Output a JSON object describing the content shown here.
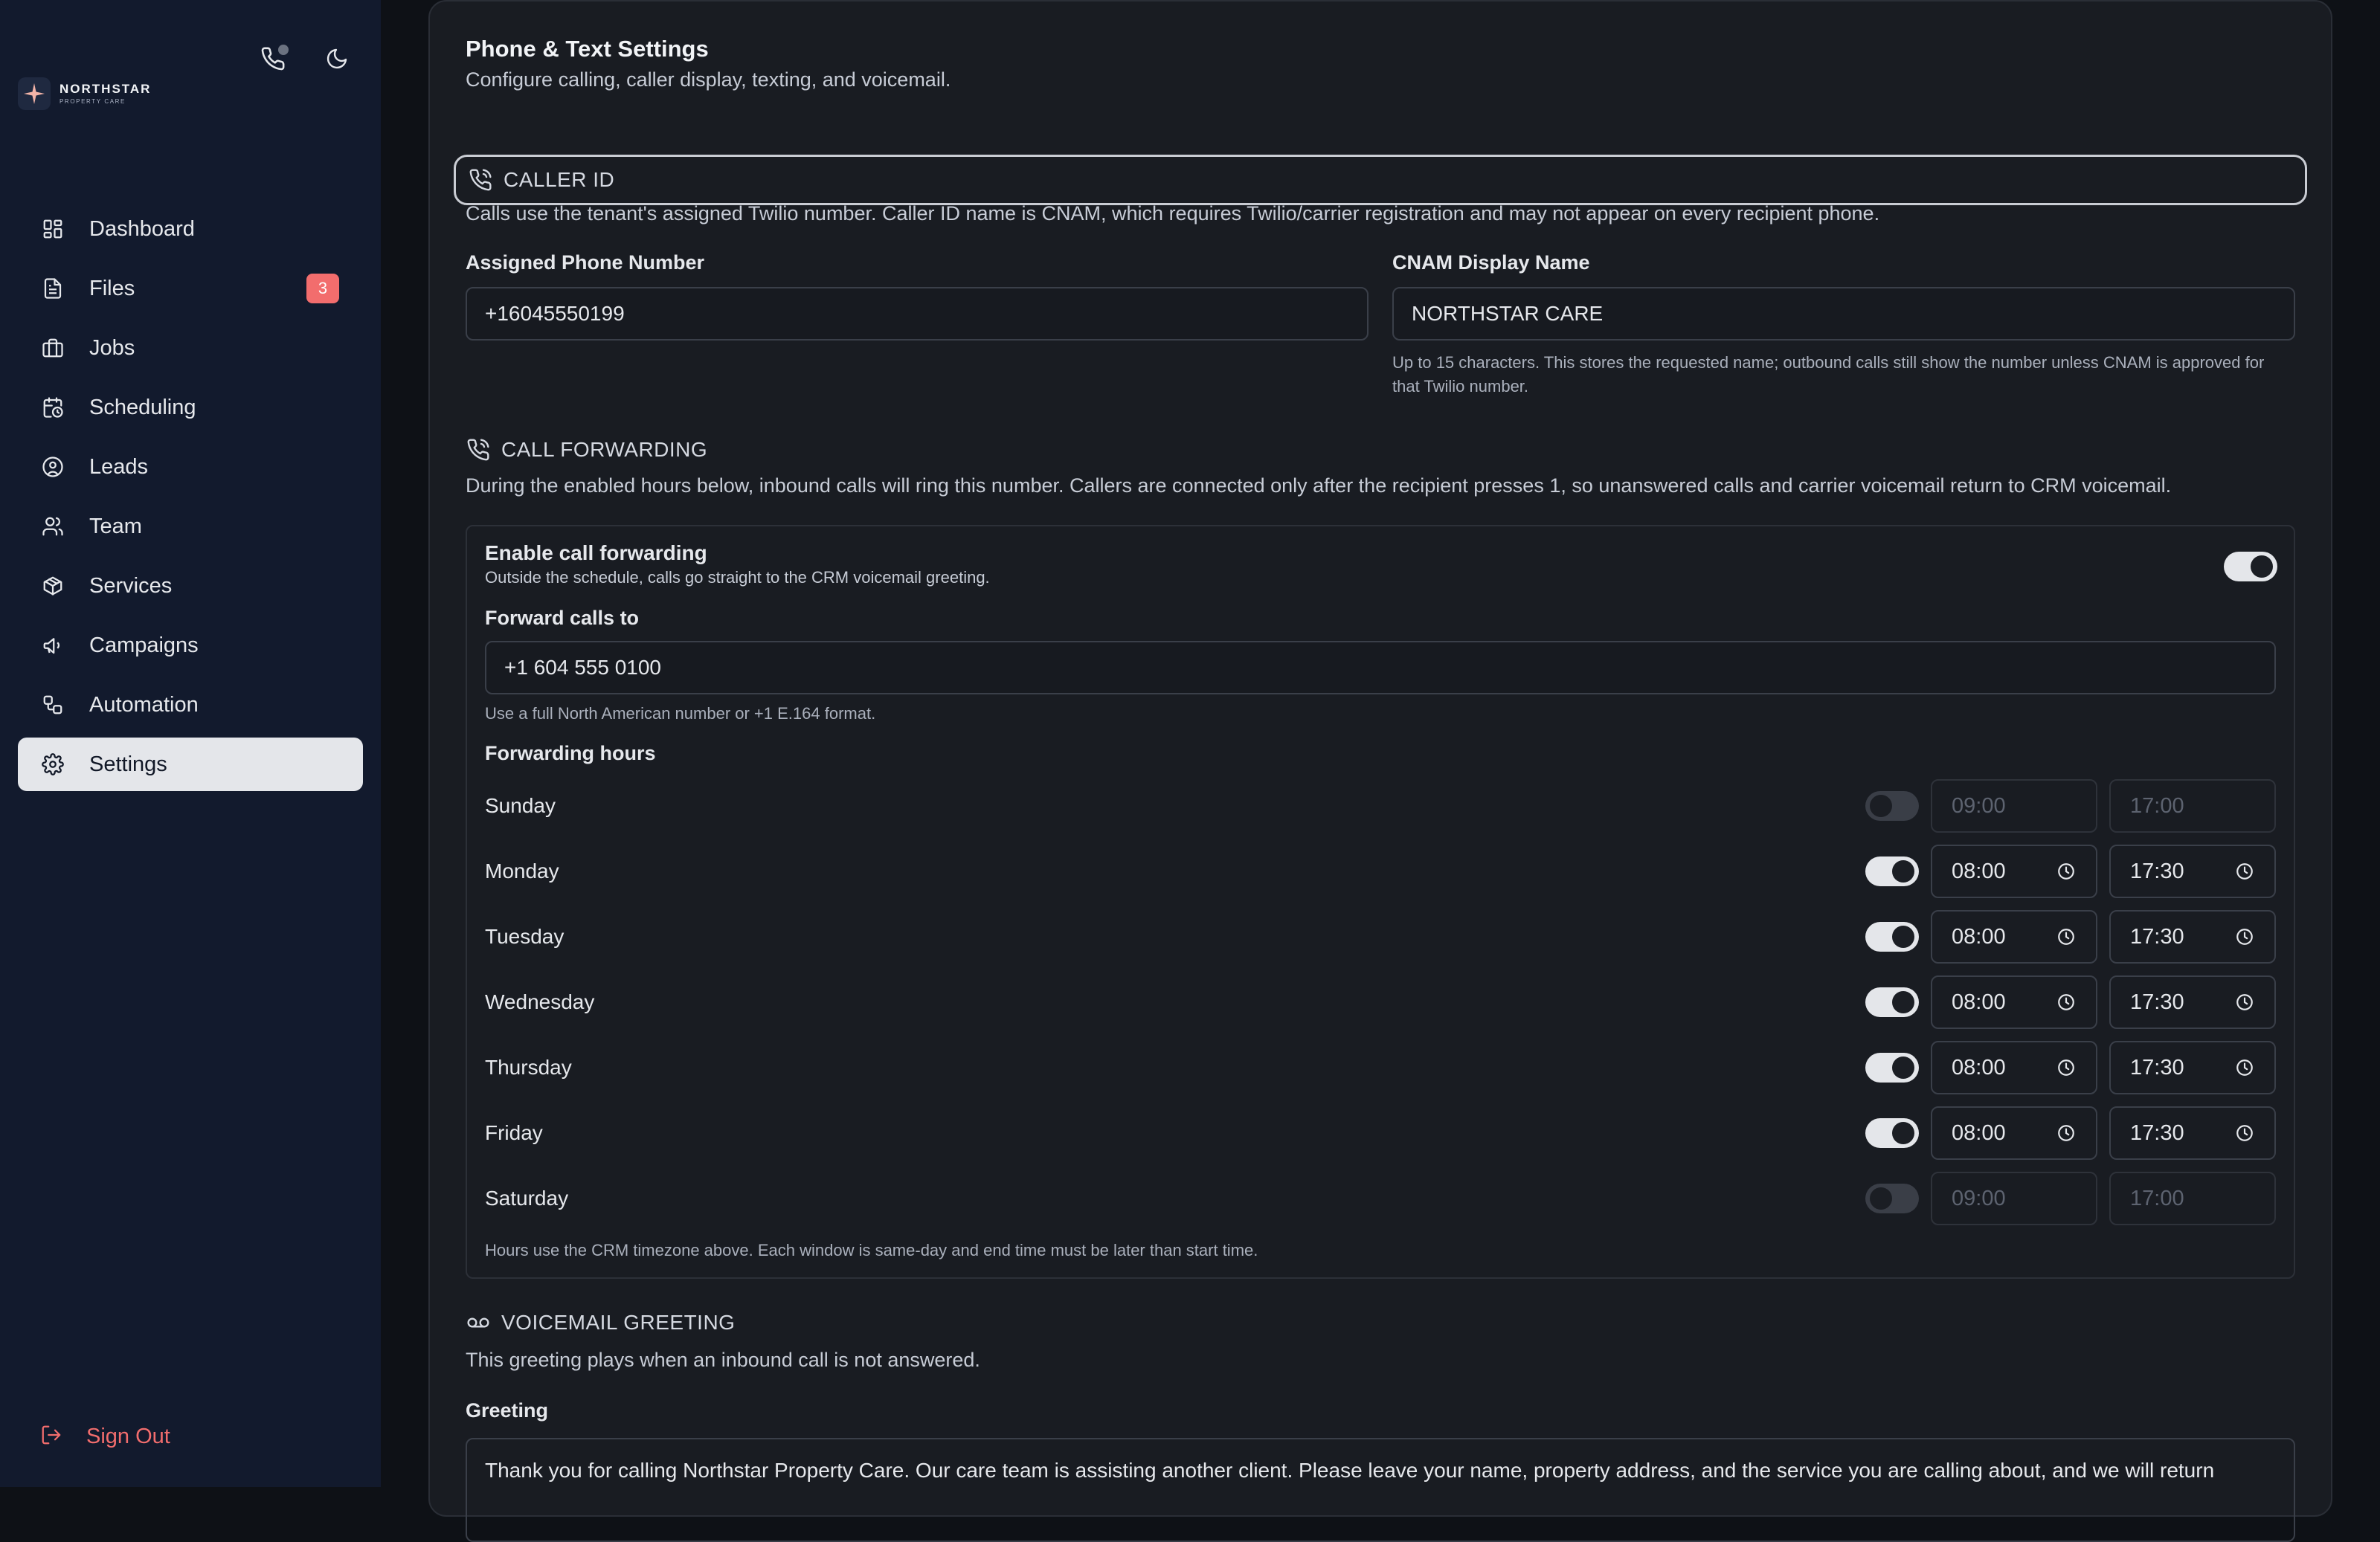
{
  "brand": {
    "name": "NORTHSTAR",
    "sub": "PROPERTY CARE"
  },
  "top_icons": [
    "phone-icon",
    "moon-icon"
  ],
  "nav": [
    {
      "label": "Dashboard",
      "icon": "dashboard-icon"
    },
    {
      "label": "Files",
      "icon": "file-icon",
      "badge": "3"
    },
    {
      "label": "Jobs",
      "icon": "briefcase-icon"
    },
    {
      "label": "Scheduling",
      "icon": "calendar-clock-icon"
    },
    {
      "label": "Leads",
      "icon": "user-circle-icon"
    },
    {
      "label": "Team",
      "icon": "users-icon"
    },
    {
      "label": "Services",
      "icon": "box-icon"
    },
    {
      "label": "Campaigns",
      "icon": "megaphone-icon"
    },
    {
      "label": "Automation",
      "icon": "workflow-icon"
    },
    {
      "label": "Settings",
      "icon": "gear-icon",
      "active": true
    }
  ],
  "signout": "Sign Out",
  "page": {
    "title": "Phone & Text Settings",
    "subtitle": "Configure calling, caller display, texting, and voicemail."
  },
  "caller_id": {
    "heading": "CALLER ID",
    "description": "Calls use the tenant's assigned Twilio number. Caller ID name is CNAM, which requires Twilio/carrier registration and may not appear on every recipient phone.",
    "phone_label": "Assigned Phone Number",
    "phone_value": "+16045550199",
    "cnam_label": "CNAM Display Name",
    "cnam_value": "NORTHSTAR CARE",
    "cnam_hint": "Up to 15 characters. This stores the requested name; outbound calls still show the number unless CNAM is approved for that Twilio number."
  },
  "forwarding": {
    "heading": "CALL FORWARDING",
    "description": "During the enabled hours below, inbound calls will ring this number. Callers are connected only after the recipient presses 1, so unanswered calls and carrier voicemail return to CRM voicemail.",
    "enable_label": "Enable call forwarding",
    "enable_sub": "Outside the schedule, calls go straight to the CRM voicemail greeting.",
    "enabled": true,
    "forward_label": "Forward calls to",
    "forward_value": "+1 604 555 0100",
    "forward_hint": "Use a full North American number or +1 E.164 format.",
    "hours_label": "Forwarding hours",
    "days": [
      {
        "name": "Sunday",
        "enabled": false,
        "start": "09:00",
        "end": "17:00"
      },
      {
        "name": "Monday",
        "enabled": true,
        "start": "08:00",
        "end": "17:30"
      },
      {
        "name": "Tuesday",
        "enabled": true,
        "start": "08:00",
        "end": "17:30"
      },
      {
        "name": "Wednesday",
        "enabled": true,
        "start": "08:00",
        "end": "17:30"
      },
      {
        "name": "Thursday",
        "enabled": true,
        "start": "08:00",
        "end": "17:30"
      },
      {
        "name": "Friday",
        "enabled": true,
        "start": "08:00",
        "end": "17:30"
      },
      {
        "name": "Saturday",
        "enabled": false,
        "start": "09:00",
        "end": "17:00"
      }
    ],
    "hours_hint": "Hours use the CRM timezone above. Each window is same-day and end time must be later than start time."
  },
  "voicemail": {
    "heading": "VOICEMAIL GREETING",
    "description": "This greeting plays when an inbound call is not answered.",
    "greeting_label": "Greeting",
    "greeting_value": "Thank you for calling Northstar Property Care. Our care team is assisting another client. Please leave your name, property address, and the service you are calling about, and we will return"
  }
}
